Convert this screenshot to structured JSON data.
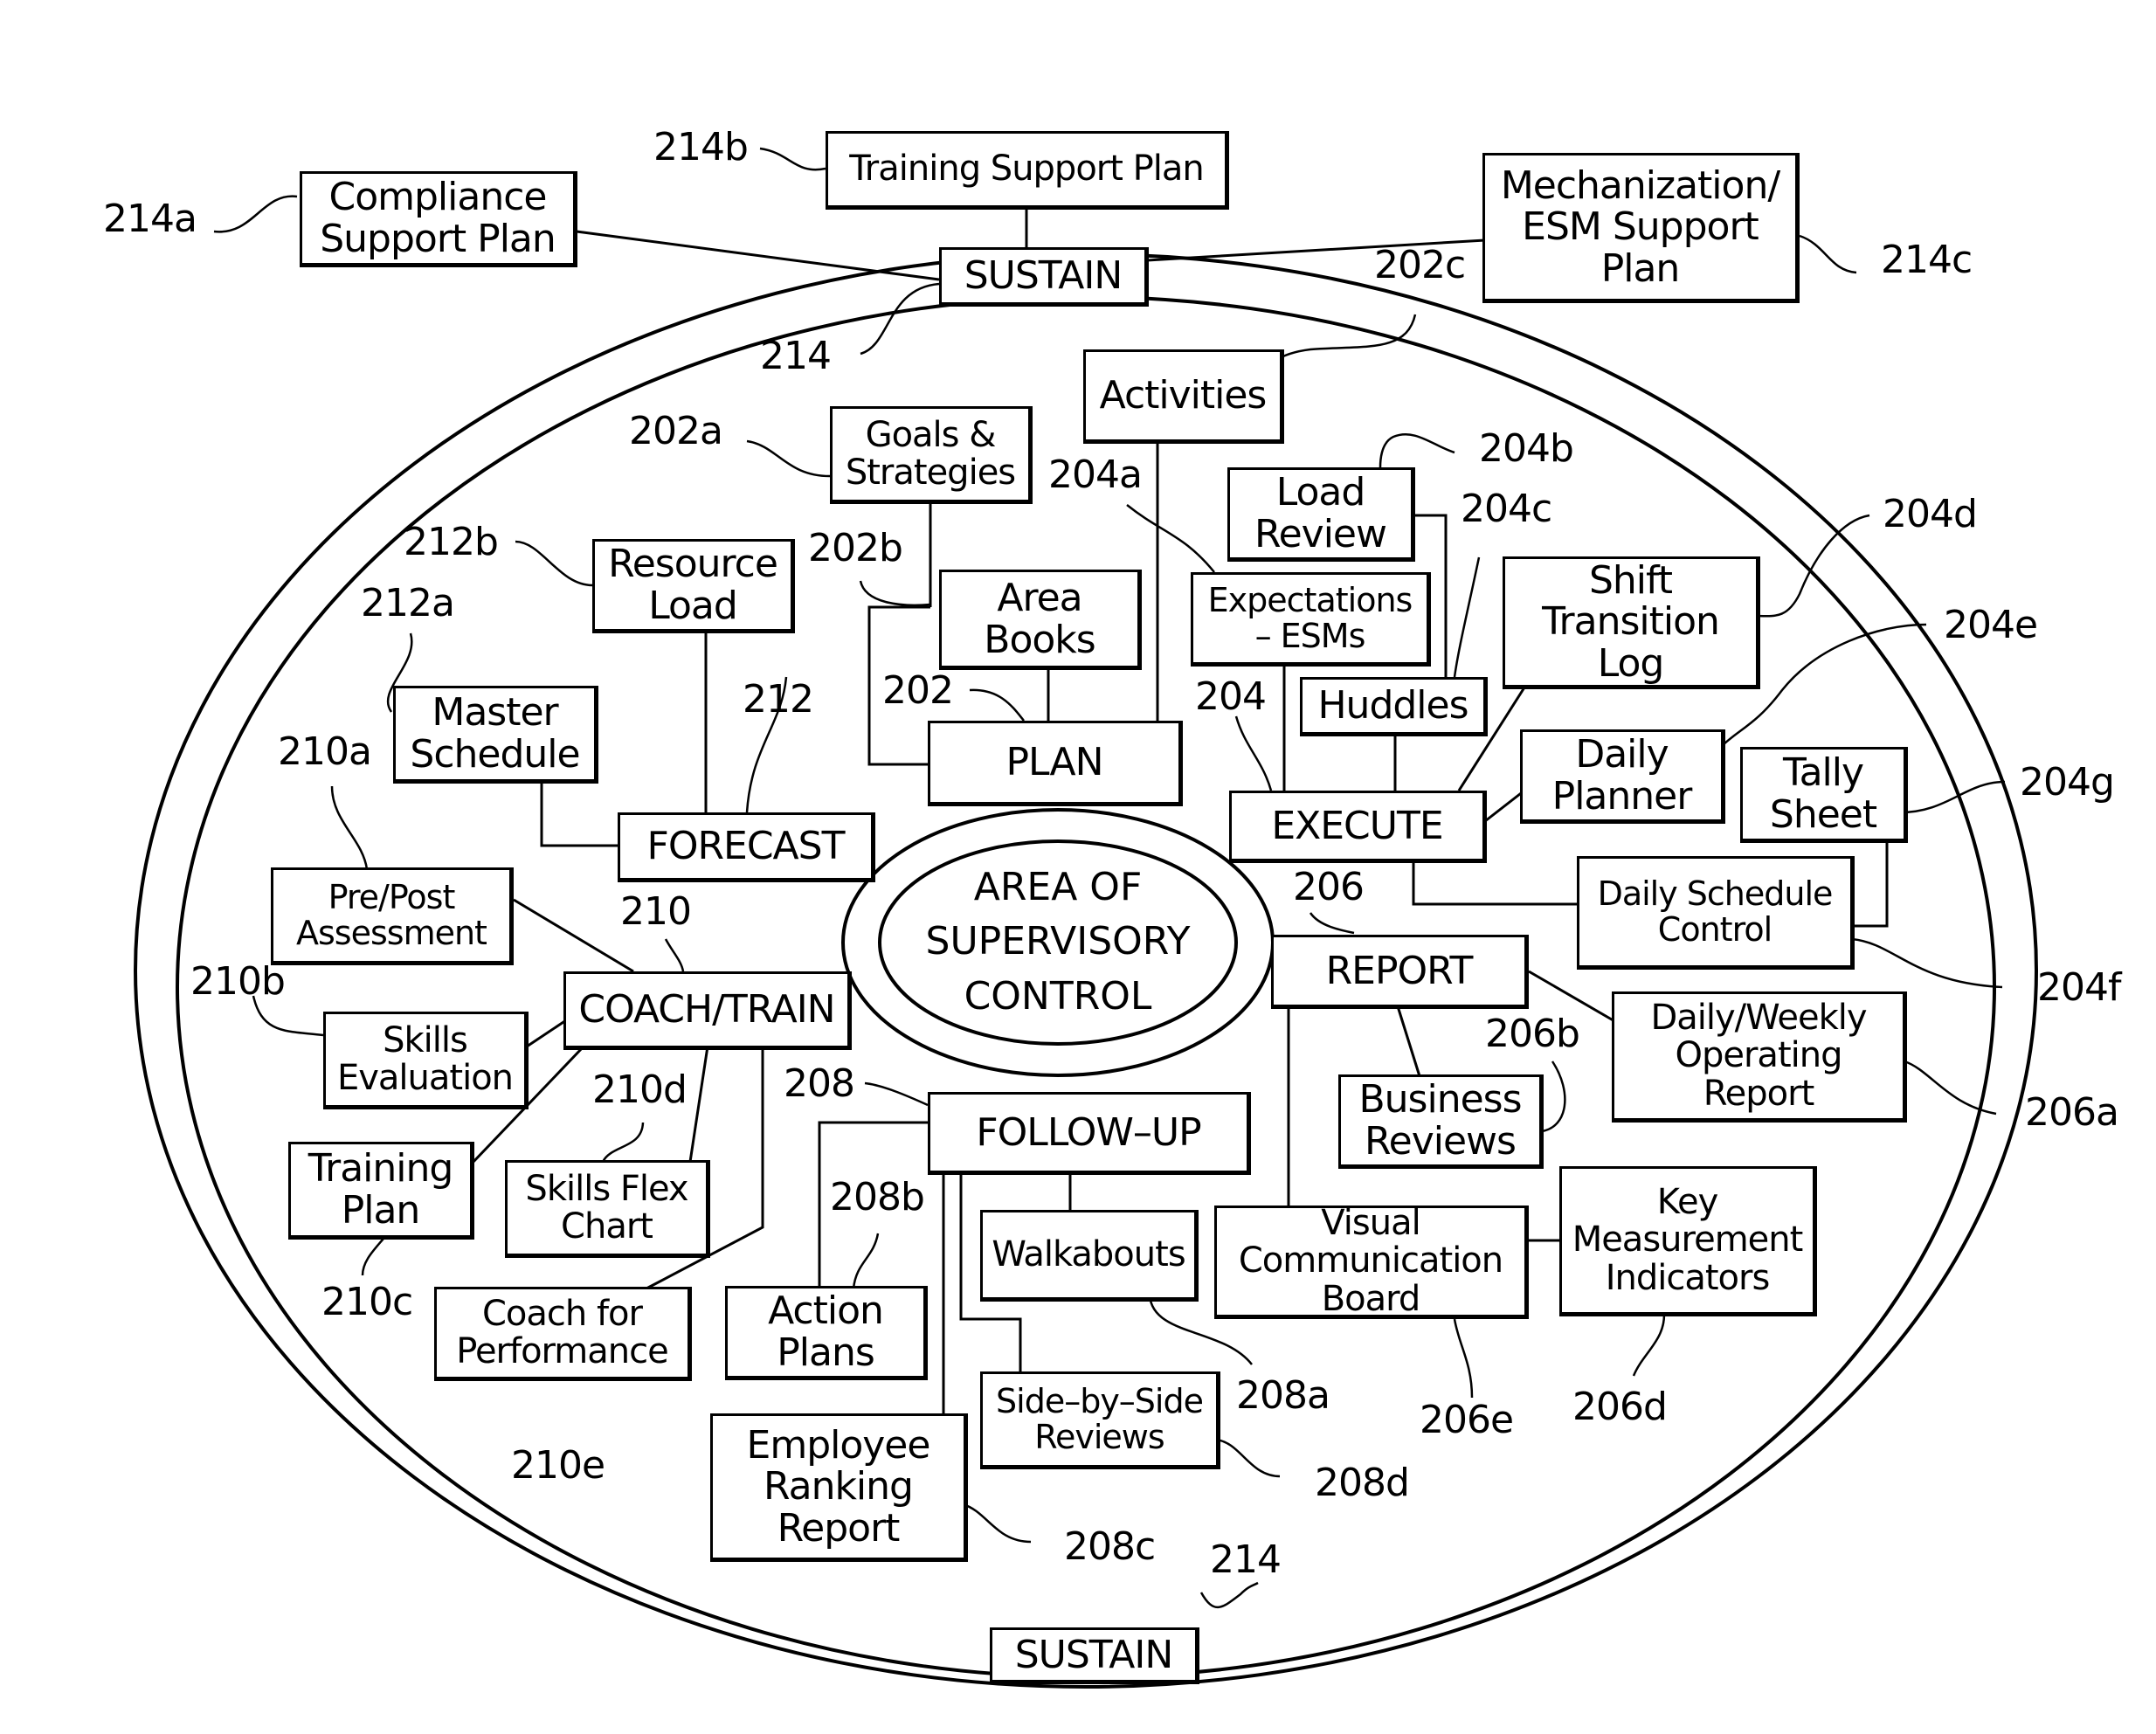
{
  "diagram": {
    "center": {
      "label": "AREA OF\nSUPERVISORY\nCONTROL"
    },
    "sustain_top": {
      "label": "SUSTAIN",
      "ref": "214"
    },
    "sustain_bottom": {
      "label": "SUSTAIN",
      "ref": "214"
    },
    "support_plans": [
      {
        "label": "Compliance\nSupport Plan",
        "ref": "214a"
      },
      {
        "label": "Training Support Plan",
        "ref": "214b"
      },
      {
        "label": "Mechanization/\nESM Support\nPlan",
        "ref": "214c"
      }
    ],
    "plan": {
      "label": "PLAN",
      "ref": "202",
      "children": [
        {
          "label": "Goals &\nStrategies",
          "ref": "202a"
        },
        {
          "label": "Area\nBooks",
          "ref": "202b"
        },
        {
          "label": "Activities",
          "ref": "202c"
        }
      ]
    },
    "execute": {
      "label": "EXECUTE",
      "ref": "204",
      "children": [
        {
          "label": "Expectations\n– ESMs",
          "ref": "204a"
        },
        {
          "label": "Load\nReview",
          "ref": "204b"
        },
        {
          "label": "Huddles",
          "ref": "204c"
        },
        {
          "label": "Shift\nTransition\nLog",
          "ref": "204d"
        },
        {
          "label": "Daily\nPlanner",
          "ref": "204e"
        },
        {
          "label": "Daily Schedule\nControl",
          "ref": "204f"
        },
        {
          "label": "Tally\nSheet",
          "ref": "204g"
        }
      ]
    },
    "report": {
      "label": "REPORT",
      "ref": "206",
      "children": [
        {
          "label": "Daily/Weekly\nOperating\nReport",
          "ref": "206a"
        },
        {
          "label": "Business\nReviews",
          "ref": "206b"
        },
        {
          "label": "Key\nMeasurement\nIndicators",
          "ref": "206d"
        },
        {
          "label": "Visual\nCommunication\nBoard",
          "ref": "206e"
        }
      ]
    },
    "follow_up": {
      "label": "FOLLOW–UP",
      "ref": "208",
      "children": [
        {
          "label": "Walkabouts",
          "ref": "208a"
        },
        {
          "label": "Action\nPlans",
          "ref": "208b"
        },
        {
          "label": "Employee\nRanking\nReport",
          "ref": "208c"
        },
        {
          "label": "Side–by–Side\nReviews",
          "ref": "208d"
        }
      ]
    },
    "coach_train": {
      "label": "COACH/TRAIN",
      "ref": "210",
      "children": [
        {
          "label": "Pre/Post\nAssessment",
          "ref": "210a"
        },
        {
          "label": "Skills\nEvaluation",
          "ref": "210b"
        },
        {
          "label": "Training\nPlan",
          "ref": "210c"
        },
        {
          "label": "Skills Flex\nChart",
          "ref": "210d"
        },
        {
          "label": "Coach for\nPerformance",
          "ref": "210e"
        }
      ]
    },
    "forecast": {
      "label": "FORECAST",
      "ref": "212",
      "children": [
        {
          "label": "Master\nSchedule",
          "ref": "212a"
        },
        {
          "label": "Resource\nLoad",
          "ref": "212b"
        }
      ]
    }
  }
}
